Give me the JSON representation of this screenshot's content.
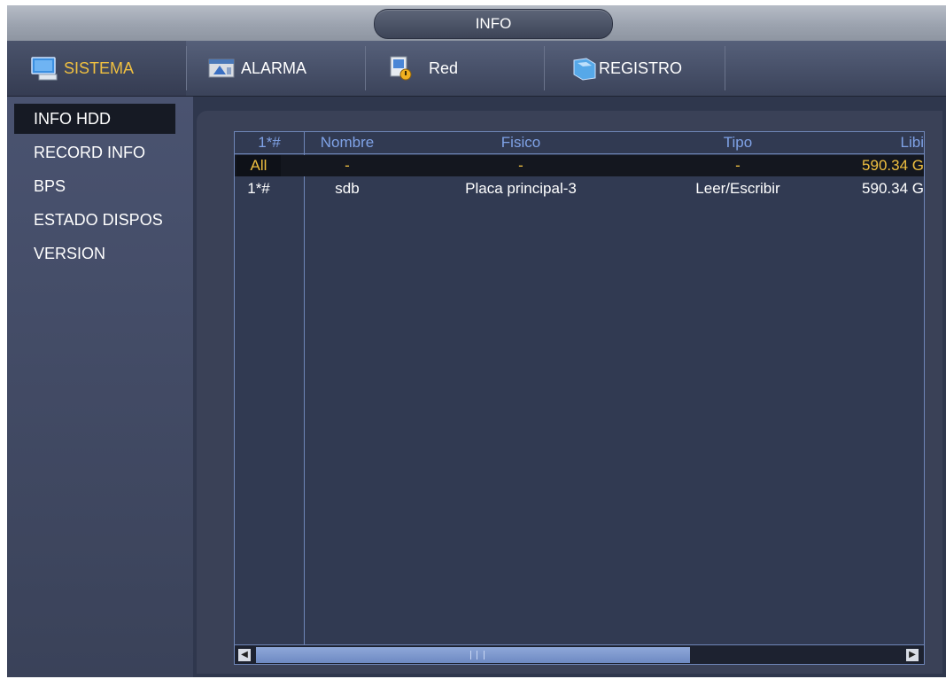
{
  "window": {
    "title": "INFO"
  },
  "tabs": [
    {
      "label": "SISTEMA",
      "icon": "monitor-icon",
      "active": true
    },
    {
      "label": "ALARMA",
      "icon": "alarm-icon",
      "active": false
    },
    {
      "label": "Red",
      "icon": "network-icon",
      "active": false
    },
    {
      "label": "REGISTRO",
      "icon": "log-icon",
      "active": false
    }
  ],
  "sidebar": {
    "items": [
      {
        "label": "INFO HDD",
        "active": true
      },
      {
        "label": "RECORD INFO",
        "active": false
      },
      {
        "label": "BPS",
        "active": false
      },
      {
        "label": "ESTADO DISPOS",
        "active": false
      },
      {
        "label": "VERSION",
        "active": false
      }
    ]
  },
  "table": {
    "columns": [
      "1*#",
      "Nombre",
      "Fisico",
      "Tipo",
      "Libi"
    ],
    "rows": [
      {
        "cells": [
          "All",
          "-",
          "-",
          "-",
          "590.34 G"
        ],
        "selected": true
      },
      {
        "cells": [
          "1*#",
          "sdb",
          "Placa principal-3",
          "Leer/Escribir",
          "590.34 G"
        ],
        "selected": false
      }
    ]
  },
  "colors": {
    "accent": "#f0c040",
    "header_text": "#7fa2e6",
    "background": "#2f374d"
  }
}
